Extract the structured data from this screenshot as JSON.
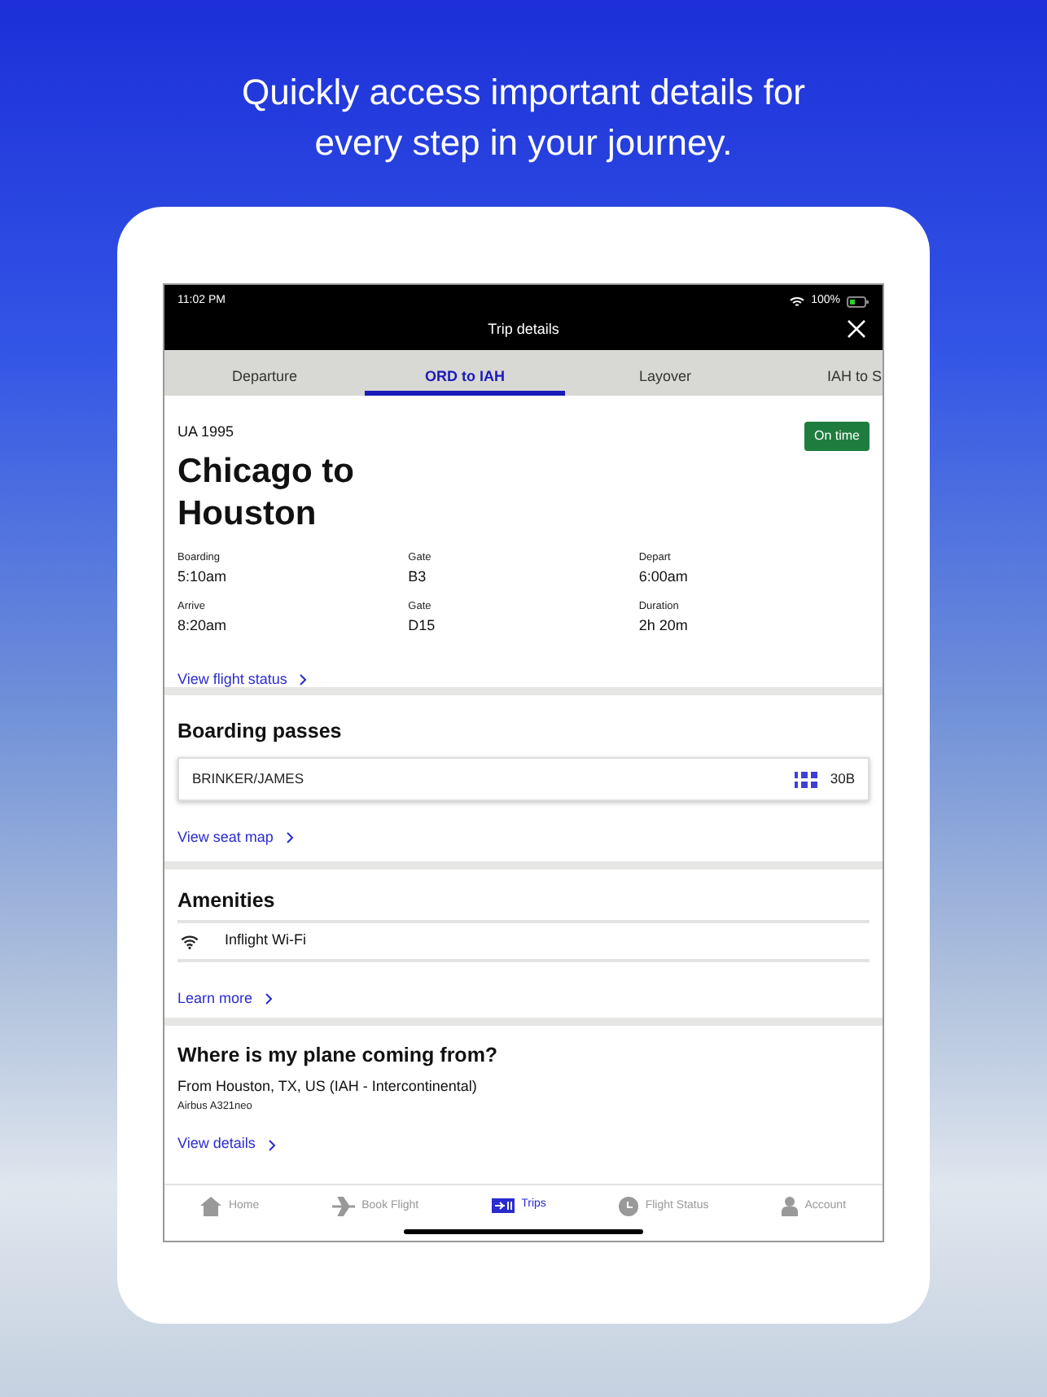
{
  "headline": "Quickly access important details for every step in your journey.",
  "status_bar": {
    "time": "11:02 PM",
    "battery": "100%"
  },
  "header": {
    "title": "Trip details"
  },
  "tabs": [
    {
      "label": "Departure",
      "selected": false
    },
    {
      "label": "ORD to IAH",
      "selected": true
    },
    {
      "label": "Layover",
      "selected": false
    },
    {
      "label": "IAH to S",
      "selected": false
    }
  ],
  "flight": {
    "number": "UA 1995",
    "status": "On time",
    "route": "Chicago to Houston",
    "details": [
      {
        "label": "Boarding",
        "value": "5:10am"
      },
      {
        "label": "Gate",
        "value": "B3"
      },
      {
        "label": "Depart",
        "value": "6:00am"
      },
      {
        "label": "Arrive",
        "value": "8:20am"
      },
      {
        "label": "Gate",
        "value": "D15"
      },
      {
        "label": "Duration",
        "value": "2h 20m"
      }
    ],
    "link": "View flight status"
  },
  "boarding_passes": {
    "title": "Boarding passes",
    "passes": [
      {
        "name": "BRINKER/JAMES",
        "seat": "30B"
      }
    ],
    "link": "View seat map"
  },
  "amenities": {
    "title": "Amenities",
    "items": [
      "Inflight Wi-Fi"
    ],
    "link": "Learn more"
  },
  "origin": {
    "title": "Where is my plane coming from?",
    "from": "From Houston, TX, US (IAH - Intercontinental)",
    "aircraft": "Airbus A321neo",
    "link": "View details"
  },
  "nav": [
    {
      "label": "Home",
      "kind": "home",
      "selected": false
    },
    {
      "label": "Book Flight",
      "kind": "plane",
      "selected": false
    },
    {
      "label": "Trips",
      "kind": "trips",
      "selected": true
    },
    {
      "label": "Flight Status",
      "kind": "clock",
      "selected": false
    },
    {
      "label": "Account",
      "kind": "person",
      "selected": false
    }
  ]
}
